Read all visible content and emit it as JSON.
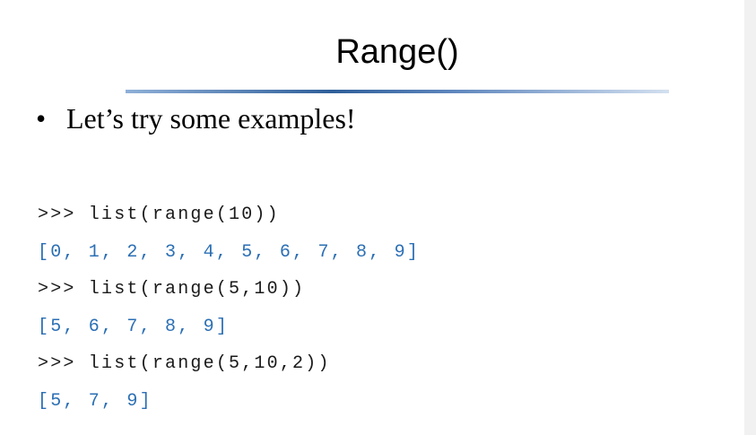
{
  "slide": {
    "title": "Range()",
    "bullet_marker": "•",
    "bullet_text": "Let’s try some examples!"
  },
  "code": {
    "lines": [
      {
        "kind": "input",
        "text": ">>> list(range(10))"
      },
      {
        "kind": "output",
        "text": "[0, 1, 2, 3, 4, 5, 6, 7, 8, 9]"
      },
      {
        "kind": "input",
        "text": ">>> list(range(5,10))"
      },
      {
        "kind": "output",
        "text": "[5, 6, 7, 8, 9]"
      },
      {
        "kind": "input",
        "text": ">>> list(range(5,10,2))"
      },
      {
        "kind": "output",
        "text": "[5, 7, 9]"
      }
    ]
  },
  "colors": {
    "output_text": "#2b6fb4",
    "title_rule": "#2f5f9a"
  }
}
